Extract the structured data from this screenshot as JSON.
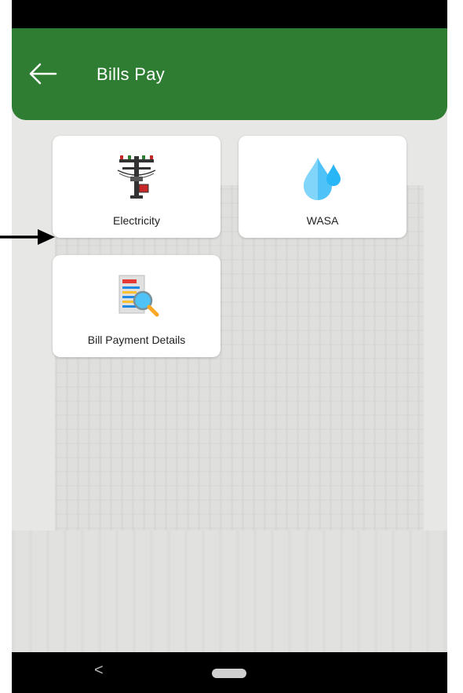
{
  "app_bar": {
    "title": "Bills Pay",
    "back_icon": "arrow-left-icon",
    "color": "#2e7d32"
  },
  "services": [
    {
      "label": "Electricity",
      "icon": "electric-pole-icon"
    },
    {
      "label": "WASA",
      "icon": "water-drop-icon"
    },
    {
      "label": "Bill Payment Details",
      "icon": "bill-search-icon"
    }
  ],
  "nav_bar": {
    "back_glyph": "<",
    "home_icon": "home-pill-icon"
  },
  "annotation": {
    "icon": "pointer-arrow-icon"
  }
}
